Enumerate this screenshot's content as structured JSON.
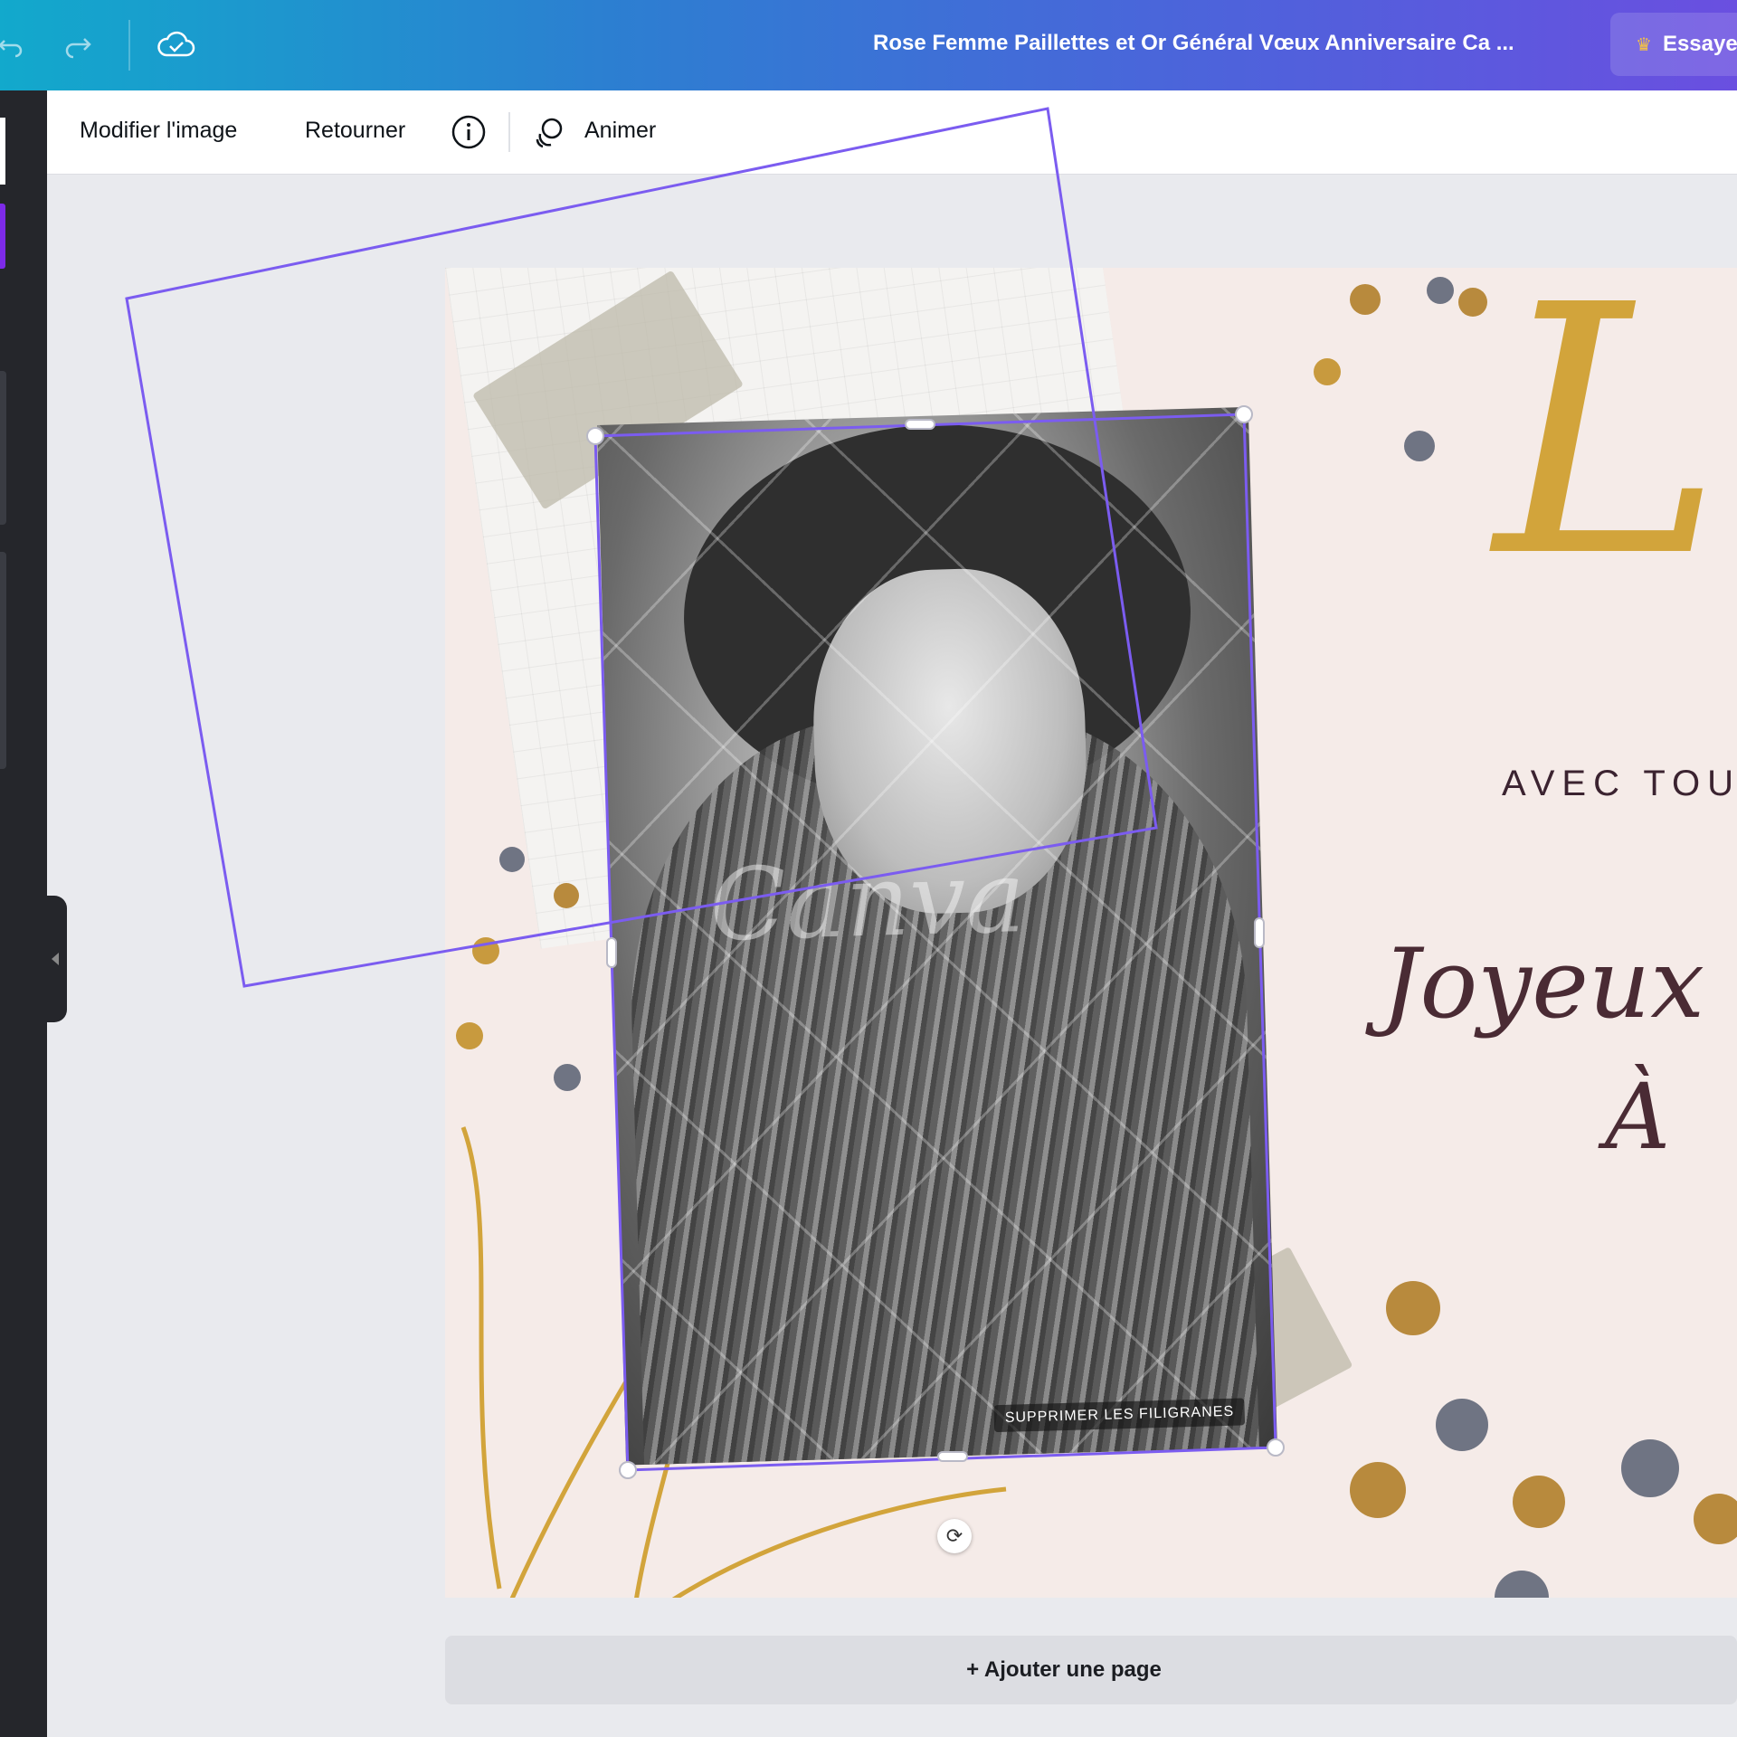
{
  "topbar": {
    "undo_icon": "undo-icon",
    "redo_icon": "redo-icon",
    "cloud_icon": "cloud-check-icon",
    "document_title": "Rose Femme Paillettes et Or Général Vœux Anniversaire Ca ...",
    "try_label": "Essaye",
    "try_icon": "crown-icon"
  },
  "context_toolbar": {
    "edit_image_label": "Modifier l'image",
    "flip_label": "Retourner",
    "info_icon": "info-icon",
    "animate_icon": "animate-icon",
    "animate_label": "Animer"
  },
  "design": {
    "watermark_text": "Canva",
    "remove_watermark_label": "SUPPRIMER LES FILIGRANES",
    "script_initial": "Le",
    "subtitle": "AVEC TOU",
    "greeting_line1": "Joyeux a",
    "greeting_line2": "À"
  },
  "footer": {
    "add_page_label": "+ Ajouter une page"
  },
  "colors": {
    "accent": "#7d2ae8",
    "selection": "#7b5cf0",
    "gold": "#d2a43b",
    "page_background": "#f5ebe8"
  }
}
